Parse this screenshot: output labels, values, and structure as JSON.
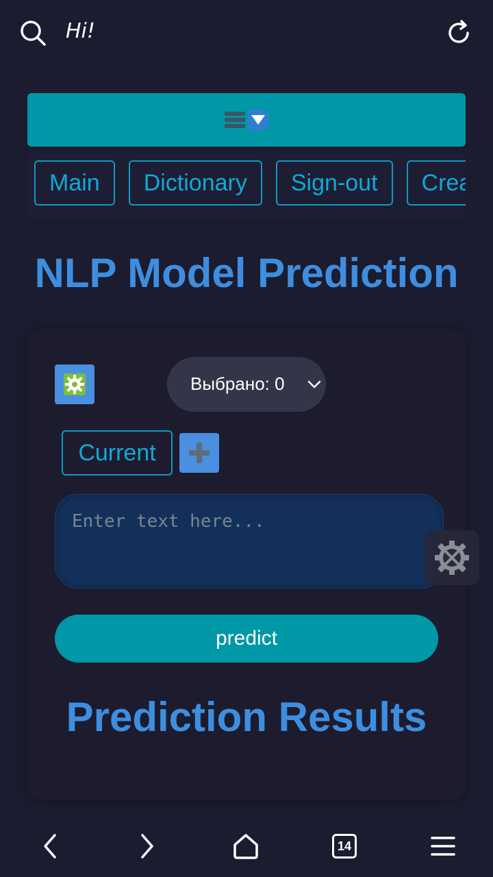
{
  "browser": {
    "greeting": "Hi!",
    "tab_count": "14"
  },
  "nav": {
    "tabs": [
      "Main",
      "Dictionary",
      "Sign-out",
      "Create"
    ]
  },
  "page": {
    "title": "NLP Model Prediction",
    "results_title": "Prediction Results"
  },
  "form": {
    "select_value": "Выбрано: 0",
    "current_label": "Current",
    "input_placeholder": "Enter text here...",
    "predict_label": "predict"
  },
  "colors": {
    "background": "#1b1c2f",
    "accent_teal": "#0097a7",
    "title_blue": "#3e8ee0",
    "tab_border": "#0f9ac4",
    "icon_button_blue": "#4a8fe0",
    "textarea_bg": "#13305a"
  },
  "icons": {
    "top_left": "search-icon",
    "top_right": "reload-icon",
    "menu": "hamburger-icon",
    "menu_arrow": "down-arrow-icon",
    "settings": "gear-icon",
    "add": "plus-icon",
    "float": "tools-gear-icon",
    "bottom": [
      "back-icon",
      "forward-icon",
      "home-icon",
      "tabs-icon",
      "menu-icon"
    ]
  }
}
